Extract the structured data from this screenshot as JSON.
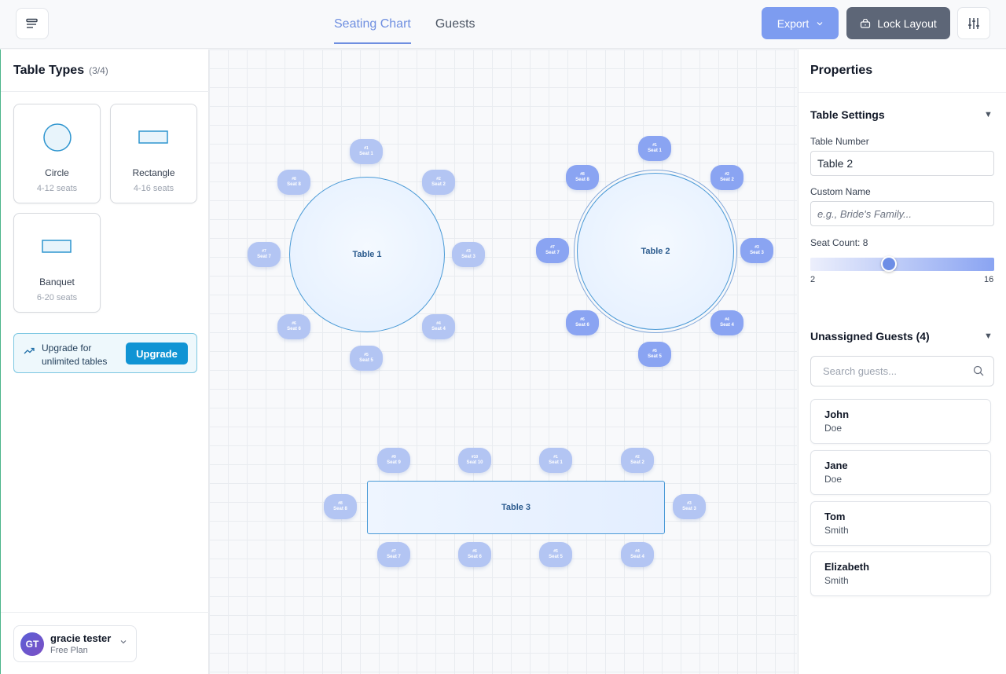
{
  "header": {
    "tabs": [
      {
        "label": "Seating Chart"
      },
      {
        "label": "Guests"
      }
    ],
    "export_label": "Export",
    "lock_label": "Lock Layout"
  },
  "sidebar": {
    "title": "Table Types",
    "count": "(3/4)",
    "table_types": [
      {
        "name": "Circle",
        "seats": "4-12 seats",
        "icon": "circle-table-icon"
      },
      {
        "name": "Rectangle",
        "seats": "4-16 seats",
        "icon": "rectangle-table-icon"
      },
      {
        "name": "Banquet",
        "seats": "6-20 seats",
        "icon": "banquet-table-icon"
      }
    ],
    "upgrade": {
      "text": "Upgrade for unlimited tables",
      "button": "Upgrade"
    },
    "user": {
      "initials": "GT",
      "name": "gracie tester",
      "plan": "Free Plan"
    }
  },
  "canvas": {
    "tables": [
      {
        "label": "Table 1",
        "seats": [
          "#1|Seat 1",
          "#2|Seat 2",
          "#3|Seat 3",
          "#4|Seat 4",
          "#5|Seat 5",
          "#6|Seat 6",
          "#7|Seat 7",
          "#8|Seat 8"
        ]
      },
      {
        "label": "Table 2",
        "selected": true,
        "seats": [
          "#1|Seat 1",
          "#2|Seat 2",
          "#3|Seat 3",
          "#4|Seat 4",
          "#5|Seat 5",
          "#6|Seat 6",
          "#7|Seat 7",
          "#8|Seat 8"
        ]
      },
      {
        "label": "Table 3",
        "seats": [
          "#1|Seat 1",
          "#2|Seat 2",
          "#3|Seat 3",
          "#4|Seat 4",
          "#5|Seat 5",
          "#6|Seat 6",
          "#7|Seat 7",
          "#8|Seat 8",
          "#9|Seat 9",
          "#10|Seat 10"
        ]
      }
    ]
  },
  "properties": {
    "title": "Properties",
    "table_settings": {
      "title": "Table Settings",
      "table_number_label": "Table Number",
      "table_number_value": "Table 2",
      "custom_name_label": "Custom Name",
      "custom_name_placeholder": "e.g., Bride's Family...",
      "seat_count_label": "Seat Count: 8",
      "seat_count": 8,
      "seat_min": "2",
      "seat_max": "16"
    },
    "unassigned": {
      "title": "Unassigned Guests (4)",
      "search_placeholder": "Search guests...",
      "guests": [
        {
          "first": "John",
          "last": "Doe"
        },
        {
          "first": "Jane",
          "last": "Doe"
        },
        {
          "first": "Tom",
          "last": "Smith"
        },
        {
          "first": "Elizabeth",
          "last": "Smith"
        }
      ]
    }
  },
  "colors": {
    "accent": "#7d9cf0",
    "lock": "#5d6677",
    "upgrade": "#1094d4",
    "table_border": "#4a9ad6"
  }
}
